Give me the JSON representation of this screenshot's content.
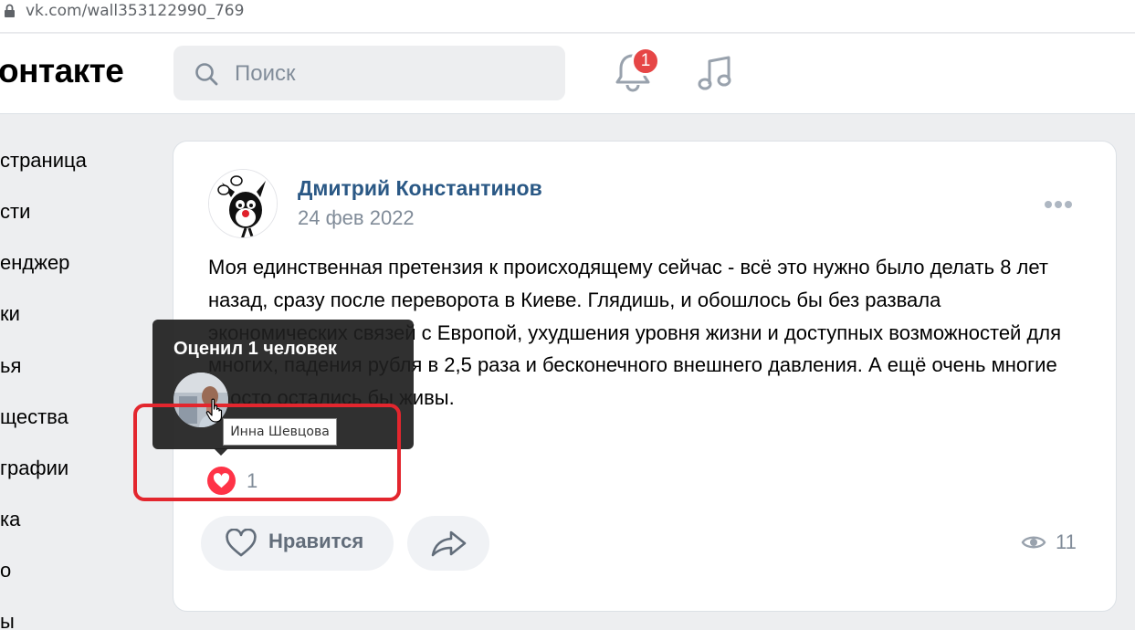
{
  "browser": {
    "url": "vk.com/wall353122990_769"
  },
  "header": {
    "logo": "онтакте",
    "search_placeholder": "Поиск",
    "notifications_count": "1"
  },
  "sidebar": {
    "items": [
      {
        "label": "страница"
      },
      {
        "label": "сти"
      },
      {
        "label": "енджер"
      },
      {
        "label": "ки"
      },
      {
        "label": "ья"
      },
      {
        "label": "щества"
      },
      {
        "label": "графии"
      },
      {
        "label": "ка"
      },
      {
        "label": "о"
      },
      {
        "label": "ы"
      }
    ]
  },
  "post": {
    "author": "Дмитрий Константинов",
    "date": "24 фев 2022",
    "text": "Моя единственная претензия к происходящему сейчас - всё это нужно было делать 8 лет назад, сразу после переворота в Киеве. Глядишь, и обошлось бы без развала экономических связей с Европой, ухудшения уровня жизни и доступных возможностей для многих, падения рубля в 2,5 раза и бесконечного внешнего давления. А ещё очень многие просто остались бы живы.",
    "likes_count": "1",
    "like_label": "Нравится",
    "views_count": "11"
  },
  "likes_tooltip": {
    "title": "Оценил 1 человек",
    "user_name": "Инна Шевцова"
  },
  "colors": {
    "accent_link": "#2a5885",
    "like_red": "#ff3347",
    "annotation_red": "#e3262e",
    "badge_red": "#e64646"
  }
}
